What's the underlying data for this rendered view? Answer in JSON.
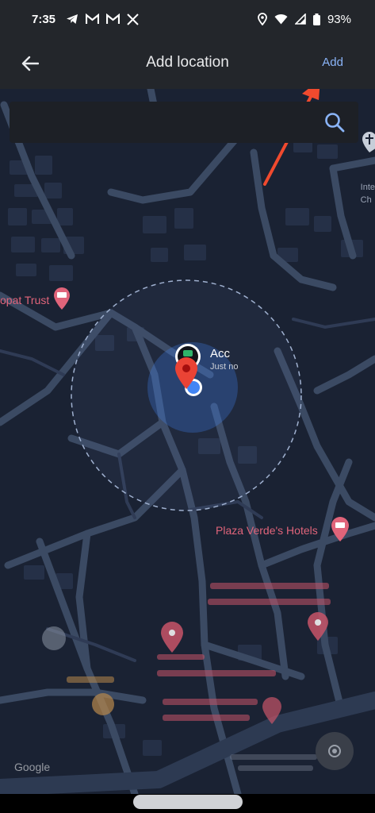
{
  "status_bar": {
    "time": "7:35",
    "notification_icons": [
      "telegram-icon",
      "gmail-icon",
      "gmail-icon",
      "x-icon"
    ],
    "system_icons": [
      "location-icon",
      "wifi-icon",
      "signal-icon",
      "battery-icon"
    ],
    "battery": "93%"
  },
  "app_bar": {
    "back_icon": "arrow-left-icon",
    "title": "Add location",
    "add_label": "Add"
  },
  "search": {
    "value": "",
    "icon": "search-icon"
  },
  "map": {
    "places": [
      {
        "label": "opat Trust",
        "icon": "hotel-icon"
      },
      {
        "label": "Plaza Verde's Hotels",
        "icon": "hotel-icon"
      }
    ],
    "edge_label": "Inte\nCh",
    "avatar": {
      "name": "Acc",
      "time": "Just no"
    },
    "footer": "Google"
  },
  "colors": {
    "accent": "#8ab4f8",
    "annotation_arrow": "#f04a2e",
    "poi": "#e0647a",
    "map_background": "#1a2233",
    "road": "#3b4a63"
  }
}
